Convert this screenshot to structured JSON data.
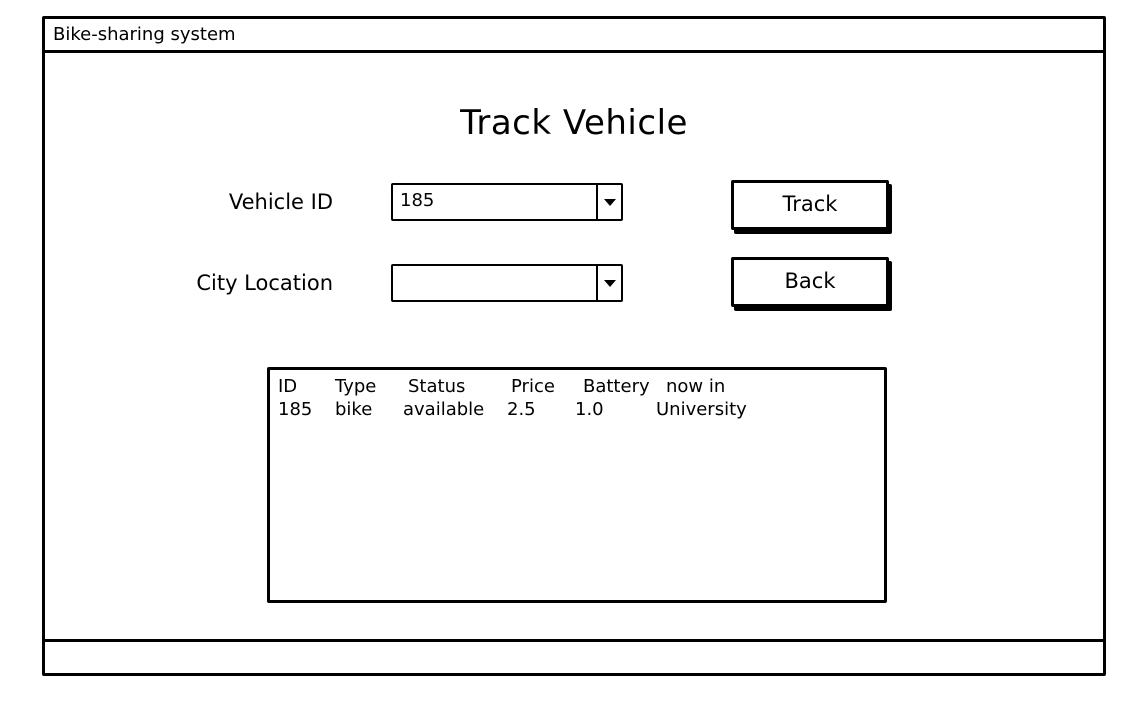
{
  "window": {
    "title": "Bike-sharing system"
  },
  "page": {
    "title": "Track Vehicle"
  },
  "form": {
    "vehicle_id": {
      "label": "Vehicle ID",
      "value": "185"
    },
    "city_location": {
      "label": "City Location",
      "value": ""
    }
  },
  "buttons": {
    "track": "Track",
    "back": "Back"
  },
  "results": {
    "columns": [
      "ID",
      "Type",
      "Status",
      "Price",
      "Battery",
      "now in"
    ],
    "rows": [
      [
        "185",
        "bike",
        "available",
        "2.5",
        "1.0",
        "University"
      ]
    ]
  }
}
